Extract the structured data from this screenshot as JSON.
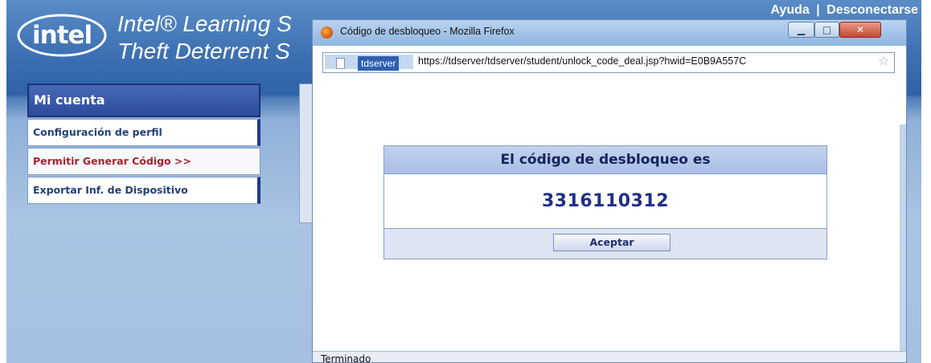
{
  "brand": {
    "logo_text": "intel",
    "title_line1": "Intel® Learning S",
    "title_line2": "Theft Deterrent S"
  },
  "top_links": {
    "help": "Ayuda",
    "separator": "|",
    "logout": "Desconectarse"
  },
  "sidebar": {
    "header": "Mi cuenta",
    "items": [
      {
        "label": "Configuración de perfil"
      },
      {
        "label": "Permitir Generar Código  >>"
      },
      {
        "label": "Exportar Inf. de Dispositivo"
      }
    ]
  },
  "popup": {
    "title": "Código de desbloqueo - Mozilla Firefox",
    "site_badge": "tdserver",
    "url": "https://tdserver/tdserver/student/unlock_code_deal.jsp?hwid=E0B9A557C",
    "dialog_heading": "El código de desbloqueo es",
    "unlock_code": "3316110312",
    "ok_button": "Aceptar",
    "status": "Terminado"
  },
  "icons": [
    "intel-logo-icon",
    "firefox-icon",
    "page-icon",
    "bookmark-star-icon",
    "minimize-icon",
    "maximize-icon",
    "close-icon"
  ],
  "colors": {
    "header_blue": "#2f62a6",
    "sidebar_active": "#a5232b",
    "code_blue": "#1f2f87"
  }
}
